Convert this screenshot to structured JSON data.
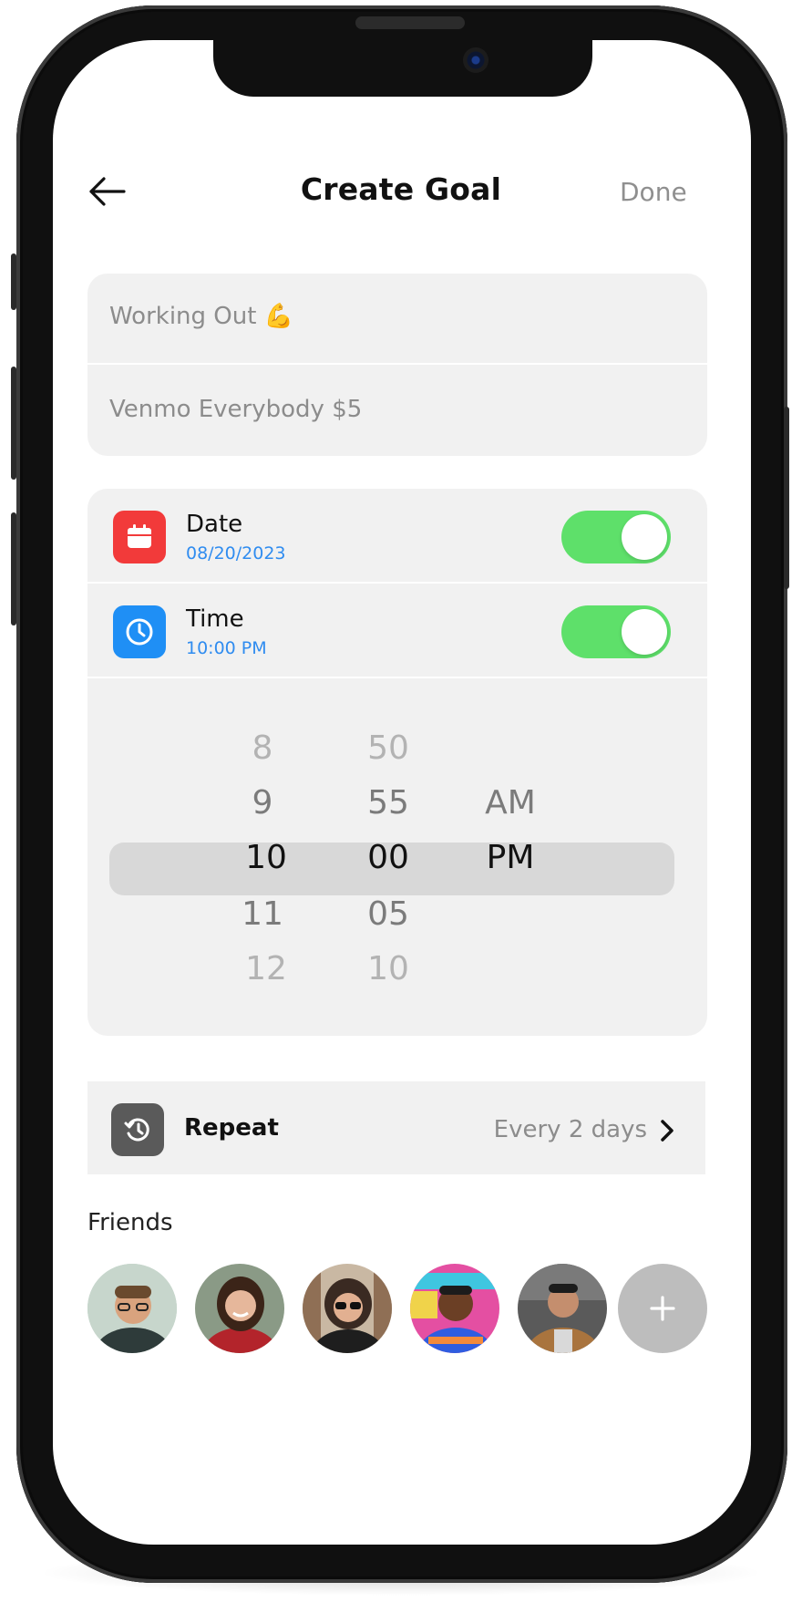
{
  "header": {
    "title": "Create Goal",
    "done_label": "Done"
  },
  "goal": {
    "name": "Working Out 💪",
    "note": "Venmo Everybody $5"
  },
  "date_row": {
    "label": "Date",
    "value": "08/20/2023",
    "enabled": true
  },
  "time_row": {
    "label": "Time",
    "value": "10:00 PM",
    "enabled": true
  },
  "picker": {
    "hours": [
      "8",
      "9",
      "10",
      "11",
      "12"
    ],
    "minutes": [
      "50",
      "55",
      "00",
      "05",
      "10"
    ],
    "periods": [
      "AM",
      "PM"
    ]
  },
  "repeat": {
    "label": "Repeat",
    "value": "Every 2 days"
  },
  "friends": {
    "label": "Friends"
  },
  "colors": {
    "accent_green": "#5ee06a",
    "date_red": "#f23a3a",
    "time_blue": "#1f8ff5",
    "link_blue": "#2f8cf0"
  }
}
